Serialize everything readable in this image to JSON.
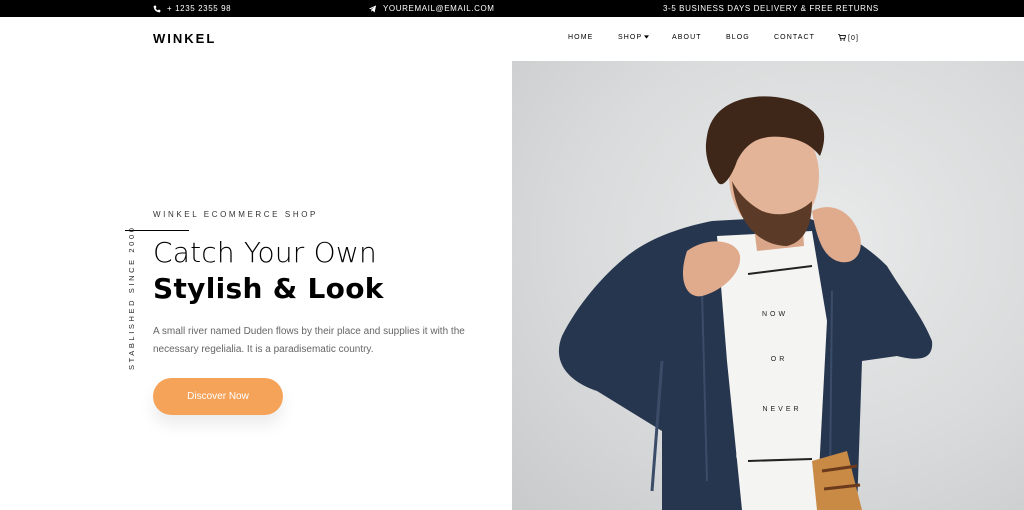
{
  "topbar": {
    "phone": "+ 1235 2355 98",
    "email": "YOUREMAIL@EMAIL.COM",
    "delivery": "3-5 BUSINESS DAYS DELIVERY & FREE RETURNS",
    "phone_icon": "phone-icon",
    "email_icon": "paper-plane-icon"
  },
  "navbar": {
    "brand": "WINKEL",
    "items": [
      "HOME",
      "SHOP",
      "ABOUT",
      "BLOG",
      "CONTACT"
    ],
    "cart_label": "[0]",
    "cart_icon": "cart-icon"
  },
  "hero": {
    "vertical_text": "STABLISHED SINCE 2000",
    "subheading": "WINKEL ECOMMERCE SHOP",
    "title_light": "Catch Your Own",
    "title_bold": "Stylish & Look",
    "description": "A small river named Duden flows by their place and supplies it with the necessary regelialia. It is a paradisematic country.",
    "button": "Discover Now",
    "image_shirt_text": [
      "NOW",
      "OR",
      "NEVER"
    ]
  },
  "colors": {
    "accent": "#f6a35a",
    "topbar_bg": "#000000",
    "text_muted": "#666666"
  }
}
